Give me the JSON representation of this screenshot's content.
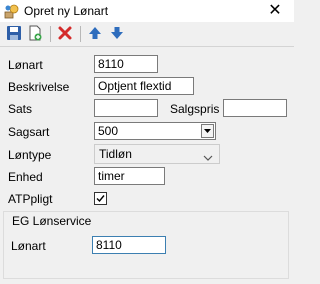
{
  "window": {
    "title": "Opret ny Lønart"
  },
  "form": {
    "lonart": {
      "label": "Lønart",
      "value": "8110"
    },
    "beskrivelse": {
      "label": "Beskrivelse",
      "value": "Optjent flextid"
    },
    "sats": {
      "label": "Sats",
      "value": ""
    },
    "salgspris": {
      "label": "Salgspris",
      "value": ""
    },
    "sagsart": {
      "label": "Sagsart",
      "value": "500"
    },
    "lontype": {
      "label": "Løntype",
      "value": "Tidløn"
    },
    "enhed": {
      "label": "Enhed",
      "value": "timer"
    },
    "atppligt": {
      "label": "ATPpligt",
      "checked": true
    }
  },
  "eg_lonservice": {
    "title": "EG Lønservice",
    "lonart": {
      "label": "Lønart",
      "value": "8110"
    }
  },
  "colors": {
    "accent_blue": "#2e6dbd",
    "delete_red": "#d42b2b",
    "focus_border": "#3c7fb1"
  }
}
